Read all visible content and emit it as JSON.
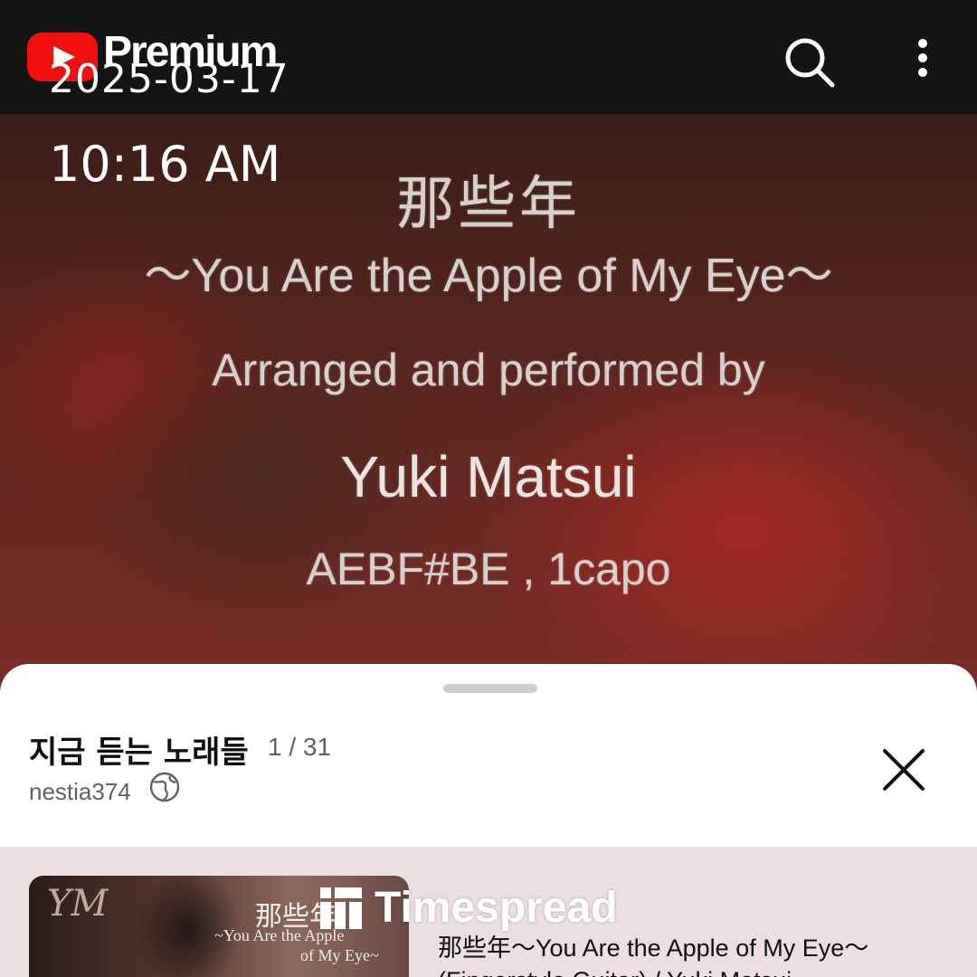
{
  "app_bar": {
    "brand_label": "Premium",
    "logo_icon": "youtube-play-icon",
    "search_icon": "search-icon",
    "menu_icon": "more-vert-icon"
  },
  "overlay": {
    "date": "2025-03-17",
    "time": "10:16 AM"
  },
  "video": {
    "lines": [
      "那些年",
      "～You Are the Apple of My Eye～",
      "Arranged and performed by",
      "Yuki Matsui",
      "AEBF#BE , 1capo"
    ]
  },
  "playlist": {
    "title": "지금 듣는 노래들",
    "position": "1 / 31",
    "owner": "nestia374",
    "visibility_icon": "globe-icon",
    "close_icon": "close-icon",
    "current_item": {
      "thumbnail_line1": "那些年",
      "thumbnail_line2": "~You Are the Apple",
      "thumbnail_line3": "of My Eye~",
      "thumbnail_mark": "YM",
      "title": "那些年～You Are the Apple of My Eye～ (Fingerstyle Guitar) / Yuki Matsui"
    }
  },
  "watermark": {
    "label": "Timespread"
  },
  "colors": {
    "brand_red": "#f20f0f",
    "topbar_bg": "#141414",
    "sheet_bg": "#ffffff",
    "active_row_bg": "#ebdfdf"
  }
}
